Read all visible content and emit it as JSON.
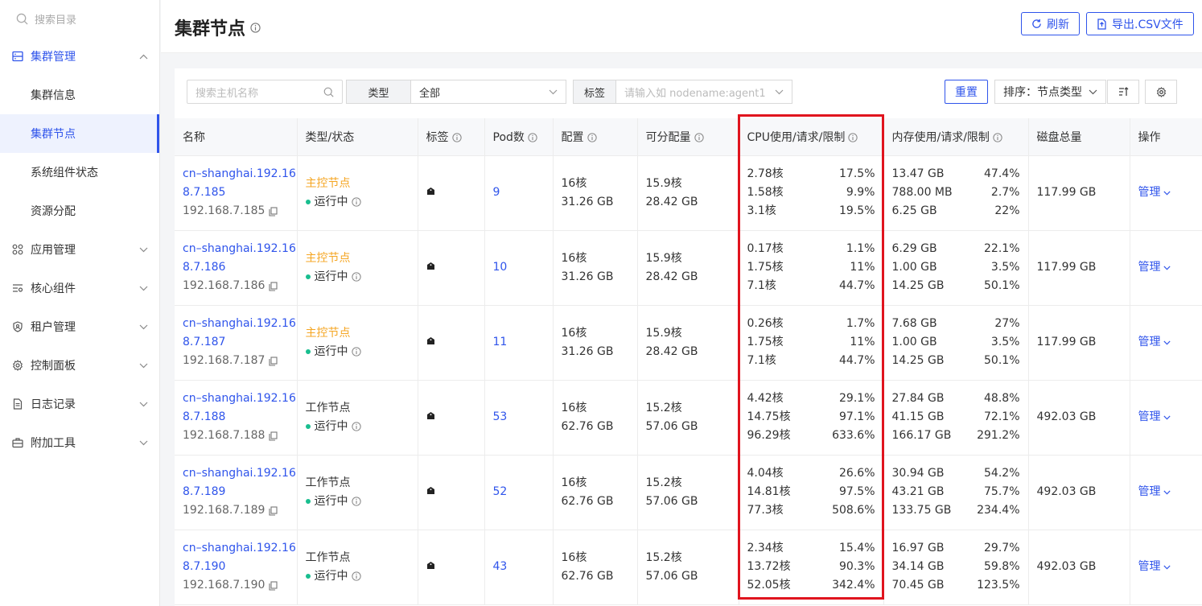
{
  "sidebar": {
    "search_placeholder": "搜索目录",
    "groups": [
      {
        "label": "集群管理",
        "icon": "server-icon",
        "expanded": true,
        "children": [
          {
            "label": "集群信息",
            "active": false
          },
          {
            "label": "集群节点",
            "active": true
          },
          {
            "label": "系统组件状态",
            "active": false
          },
          {
            "label": "资源分配",
            "active": false
          }
        ]
      },
      {
        "label": "应用管理",
        "icon": "apps-grid-icon"
      },
      {
        "label": "核心组件",
        "icon": "list-settings-icon"
      },
      {
        "label": "租户管理",
        "icon": "shield-user-icon"
      },
      {
        "label": "控制面板",
        "icon": "gear-icon"
      },
      {
        "label": "日志记录",
        "icon": "document-icon"
      },
      {
        "label": "附加工具",
        "icon": "toolbox-icon"
      }
    ]
  },
  "header": {
    "title": "集群节点",
    "refresh_label": "刷新",
    "export_label": "导出.CSV文件"
  },
  "filters": {
    "host_placeholder": "搜索主机名称",
    "type_label": "类型",
    "type_value": "全部",
    "tag_label": "标签",
    "tag_placeholder": "请输入如 nodename:agent1",
    "reset_label": "重置",
    "sort_label": "排序：节点类型"
  },
  "table": {
    "columns": [
      "名称",
      "类型/状态",
      "标签",
      "Pod数",
      "配置",
      "可分配量",
      "CPU使用/请求/限制",
      "内存使用/请求/限制",
      "磁盘总量",
      "操作"
    ],
    "rows": [
      {
        "host_line1": "cn–shanghai.192.16",
        "host_line2": "8.7.185",
        "ip": "192.168.7.185",
        "type": "主控节点",
        "kind": "master",
        "status": "运行中",
        "pods": "9",
        "cfg_cpu": "16核",
        "cfg_mem": "31.26 GB",
        "alloc_cpu": "15.9核",
        "alloc_mem": "28.42 GB",
        "cpu": [
          [
            "2.78核",
            "17.5%"
          ],
          [
            "1.58核",
            "9.9%"
          ],
          [
            "3.1核",
            "19.5%"
          ]
        ],
        "mem": [
          [
            "13.47 GB",
            "47.4%"
          ],
          [
            "788.00 MB",
            "2.7%"
          ],
          [
            "6.25 GB",
            "22%"
          ]
        ],
        "disk": "117.99 GB",
        "action": "管理"
      },
      {
        "host_line1": "cn–shanghai.192.16",
        "host_line2": "8.7.186",
        "ip": "192.168.7.186",
        "type": "主控节点",
        "kind": "master",
        "status": "运行中",
        "pods": "10",
        "cfg_cpu": "16核",
        "cfg_mem": "31.26 GB",
        "alloc_cpu": "15.9核",
        "alloc_mem": "28.42 GB",
        "cpu": [
          [
            "0.17核",
            "1.1%"
          ],
          [
            "1.75核",
            "11%"
          ],
          [
            "7.1核",
            "44.7%"
          ]
        ],
        "mem": [
          [
            "6.29 GB",
            "22.1%"
          ],
          [
            "1.00 GB",
            "3.5%"
          ],
          [
            "14.25 GB",
            "50.1%"
          ]
        ],
        "disk": "117.99 GB",
        "action": "管理"
      },
      {
        "host_line1": "cn–shanghai.192.16",
        "host_line2": "8.7.187",
        "ip": "192.168.7.187",
        "type": "主控节点",
        "kind": "master",
        "status": "运行中",
        "pods": "11",
        "cfg_cpu": "16核",
        "cfg_mem": "31.26 GB",
        "alloc_cpu": "15.9核",
        "alloc_mem": "28.42 GB",
        "cpu": [
          [
            "0.26核",
            "1.7%"
          ],
          [
            "1.75核",
            "11%"
          ],
          [
            "7.1核",
            "44.7%"
          ]
        ],
        "mem": [
          [
            "7.68 GB",
            "27%"
          ],
          [
            "1.00 GB",
            "3.5%"
          ],
          [
            "14.25 GB",
            "50.1%"
          ]
        ],
        "disk": "117.99 GB",
        "action": "管理"
      },
      {
        "host_line1": "cn–shanghai.192.16",
        "host_line2": "8.7.188",
        "ip": "192.168.7.188",
        "type": "工作节点",
        "kind": "worker",
        "status": "运行中",
        "pods": "53",
        "cfg_cpu": "16核",
        "cfg_mem": "62.76 GB",
        "alloc_cpu": "15.2核",
        "alloc_mem": "57.06 GB",
        "cpu": [
          [
            "4.42核",
            "29.1%"
          ],
          [
            "14.75核",
            "97.1%"
          ],
          [
            "96.29核",
            "633.6%"
          ]
        ],
        "mem": [
          [
            "27.84 GB",
            "48.8%"
          ],
          [
            "41.15 GB",
            "72.1%"
          ],
          [
            "166.17 GB",
            "291.2%"
          ]
        ],
        "disk": "492.03 GB",
        "action": "管理"
      },
      {
        "host_line1": "cn–shanghai.192.16",
        "host_line2": "8.7.189",
        "ip": "192.168.7.189",
        "type": "工作节点",
        "kind": "worker",
        "status": "运行中",
        "pods": "52",
        "cfg_cpu": "16核",
        "cfg_mem": "62.76 GB",
        "alloc_cpu": "15.2核",
        "alloc_mem": "57.06 GB",
        "cpu": [
          [
            "4.04核",
            "26.6%"
          ],
          [
            "14.81核",
            "97.5%"
          ],
          [
            "77.3核",
            "508.6%"
          ]
        ],
        "mem": [
          [
            "30.94 GB",
            "54.2%"
          ],
          [
            "43.21 GB",
            "75.7%"
          ],
          [
            "133.75 GB",
            "234.4%"
          ]
        ],
        "disk": "492.03 GB",
        "action": "管理"
      },
      {
        "host_line1": "cn–shanghai.192.16",
        "host_line2": "8.7.190",
        "ip": "192.168.7.190",
        "type": "工作节点",
        "kind": "worker",
        "status": "运行中",
        "pods": "43",
        "cfg_cpu": "16核",
        "cfg_mem": "62.76 GB",
        "alloc_cpu": "15.2核",
        "alloc_mem": "57.06 GB",
        "cpu": [
          [
            "2.34核",
            "15.4%"
          ],
          [
            "13.72核",
            "90.3%"
          ],
          [
            "52.05核",
            "342.4%"
          ]
        ],
        "mem": [
          [
            "16.97 GB",
            "29.7%"
          ],
          [
            "34.14 GB",
            "59.8%"
          ],
          [
            "70.45 GB",
            "123.5%"
          ]
        ],
        "disk": "492.03 GB",
        "action": "管理"
      }
    ]
  },
  "colors": {
    "accent": "#2f54eb",
    "master": "#f5a623",
    "running": "#19be8f",
    "highlight": "#e0141e"
  }
}
